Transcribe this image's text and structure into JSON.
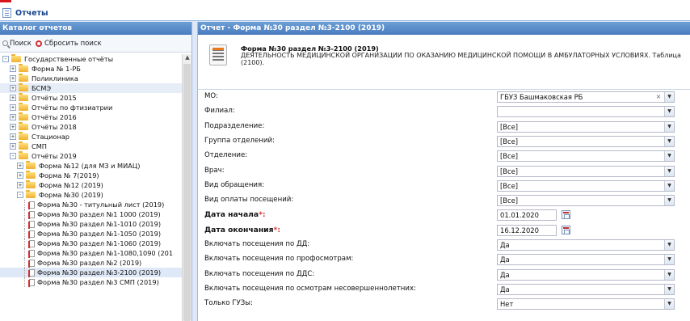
{
  "window": {
    "title": "Отчеты"
  },
  "catalog": {
    "header": "Каталог отчетов",
    "search_label": "Поиск",
    "reset_label": "Сбросить поиск",
    "tree": [
      {
        "label": "Государственные отчёты",
        "level": 0,
        "type": "folder",
        "exp": "-"
      },
      {
        "label": "Форма № 1-РБ",
        "level": 1,
        "type": "folder",
        "exp": "+"
      },
      {
        "label": "Поликлиника",
        "level": 1,
        "type": "folder",
        "exp": "+"
      },
      {
        "label": "БСМЭ",
        "level": 1,
        "type": "folder",
        "exp": "+",
        "hl": true
      },
      {
        "label": "Отчёты 2015",
        "level": 1,
        "type": "folder",
        "exp": "+"
      },
      {
        "label": "Отчёты по фтизиатрии",
        "level": 1,
        "type": "folder",
        "exp": "+"
      },
      {
        "label": "Отчёты 2016",
        "level": 1,
        "type": "folder",
        "exp": "+"
      },
      {
        "label": "Отчёты 2018",
        "level": 1,
        "type": "folder",
        "exp": "+"
      },
      {
        "label": "Стационар",
        "level": 1,
        "type": "folder",
        "exp": "+"
      },
      {
        "label": "СМП",
        "level": 1,
        "type": "folder",
        "exp": "+"
      },
      {
        "label": "Отчёты 2019",
        "level": 1,
        "type": "folder",
        "exp": "-"
      },
      {
        "label": "Форма №12 (для МЗ и МИАЦ)",
        "level": 2,
        "type": "folder",
        "exp": "+"
      },
      {
        "label": "Форма № 7(2019)",
        "level": 2,
        "type": "folder",
        "exp": "+"
      },
      {
        "label": "Форма №12 (2019)",
        "level": 2,
        "type": "folder",
        "exp": "+"
      },
      {
        "label": "Форма №30 (2019)",
        "level": 2,
        "type": "folder",
        "exp": "-"
      },
      {
        "label": "Форма №30 - титульный лист (2019)",
        "level": 3,
        "type": "doc"
      },
      {
        "label": "Форма №30 раздел №1 1000 (2019)",
        "level": 3,
        "type": "doc"
      },
      {
        "label": "Форма №30 раздел №1-1010 (2019)",
        "level": 3,
        "type": "doc"
      },
      {
        "label": "Форма №30 раздел №1-1050 (2019)",
        "level": 3,
        "type": "doc"
      },
      {
        "label": "Форма №30 раздел №1-1060 (2019)",
        "level": 3,
        "type": "doc"
      },
      {
        "label": "Форма №30 раздел №1-1080,1090 (201",
        "level": 3,
        "type": "doc"
      },
      {
        "label": "Форма №30 раздел №2 (2019)",
        "level": 3,
        "type": "doc"
      },
      {
        "label": "Форма №30 раздел №3-2100 (2019)",
        "level": 3,
        "type": "doc",
        "selected": true
      },
      {
        "label": "Форма №30 раздел №3 СМП (2019)",
        "level": 3,
        "type": "doc"
      }
    ]
  },
  "report": {
    "header": "Отчет - Форма №30 раздел №3-2100 (2019)",
    "title": "Форма №30 раздел №3-2100 (2019)",
    "description": "ДЕЯТЕЛЬНОСТЬ МЕДИЦИНСКОЙ ОРГАНИЗАЦИИ ПО ОКАЗАНИЮ МЕДИЦИНСКОЙ ПОМОЩИ В АМБУЛАТОРНЫХ УСЛОВИЯХ. Таблица (2100).",
    "fields": [
      {
        "label": "МО:",
        "value": "ГБУЗ Башмаковская РБ",
        "kind": "combo",
        "clear": true
      },
      {
        "label": "Филиал:",
        "value": "",
        "kind": "combo"
      },
      {
        "label": "Подразделение:",
        "value": "[Все]",
        "kind": "combo"
      },
      {
        "label": "Группа отделений:",
        "value": "[Все]",
        "kind": "combo"
      },
      {
        "label": "Отделение:",
        "value": "[Все]",
        "kind": "combo"
      },
      {
        "label": "Врач:",
        "value": "[Все]",
        "kind": "combo"
      },
      {
        "label": "Вид обращения:",
        "value": "[Все]",
        "kind": "combo"
      },
      {
        "label": "Вид оплаты посещений:",
        "value": "[Все]",
        "kind": "combo"
      },
      {
        "label": "Дата начала",
        "value": "01.01.2020",
        "kind": "date",
        "required": true
      },
      {
        "label": "Дата окончания",
        "value": "16.12.2020",
        "kind": "date",
        "required": true
      },
      {
        "label": "Включать посещения по ДД:",
        "value": "Да",
        "kind": "combo"
      },
      {
        "label": "Включать посещения по профосмотрам:",
        "value": "Да",
        "kind": "combo"
      },
      {
        "label": "Включать посещения по ДДС:",
        "value": "Да",
        "kind": "combo"
      },
      {
        "label": "Включать посещения по осмотрам несовершеннолетних:",
        "value": "Да",
        "kind": "combo"
      },
      {
        "label": "Только ГУЗы:",
        "value": "Нет",
        "kind": "combo"
      }
    ]
  }
}
